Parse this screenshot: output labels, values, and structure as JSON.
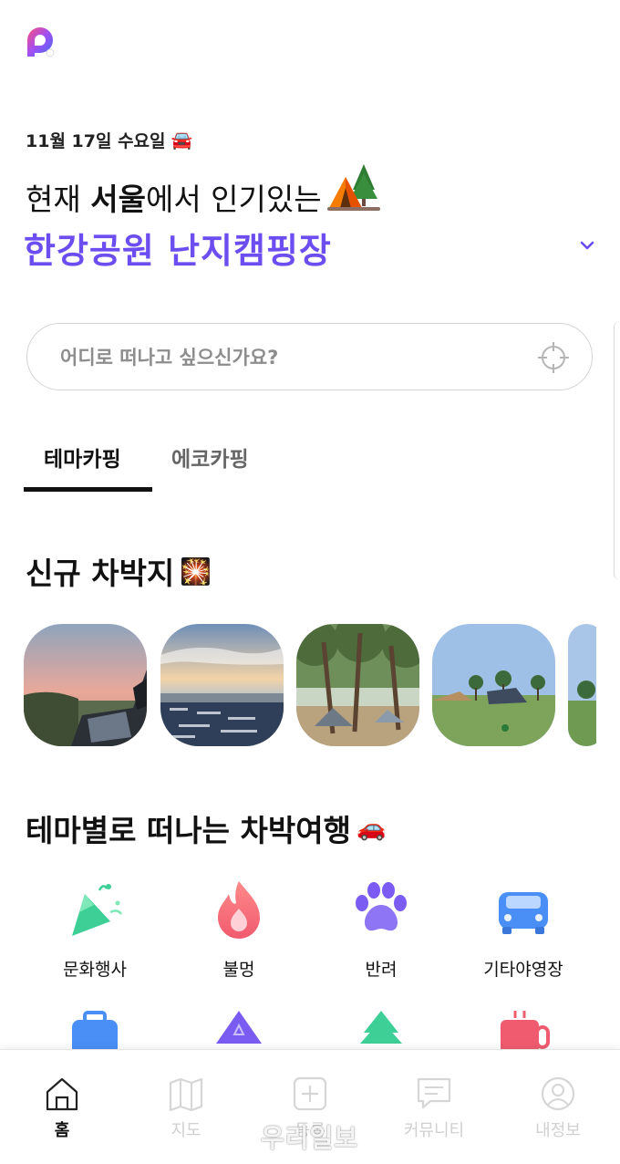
{
  "header": {
    "logo_icon": "app-logo",
    "date": "11월 17일 수요일",
    "date_emoji": "🚘",
    "headline_prefix": "현재 ",
    "headline_city": "서울",
    "headline_suffix": "에서 인기있는",
    "headline_icon": "tent-icon",
    "featured_spot": "한강공원 난지캠핑장",
    "accent_color": "#6b4df0"
  },
  "search": {
    "placeholder": "어디로 떠나고 싶으신가요?",
    "locate_icon": "crosshair-icon"
  },
  "tabs": [
    {
      "label": "테마카핑",
      "active": true
    },
    {
      "label": "에코카핑",
      "active": false
    }
  ],
  "new_spots": {
    "title": "신규 차박지",
    "title_emoji": "🎇",
    "thumbnails": [
      {
        "name": "sunset-car-photo"
      },
      {
        "name": "coast-sunset-photo"
      },
      {
        "name": "pine-forest-camp-photo"
      },
      {
        "name": "field-campsite-photo"
      },
      {
        "name": "campsite-photo-partial"
      }
    ]
  },
  "themes": {
    "title": "테마별로 떠나는 차박여행",
    "title_emoji": "🚗",
    "items": [
      {
        "label": "문화행사",
        "icon": "party-popper-icon",
        "color": "#3dcf95"
      },
      {
        "label": "불멍",
        "icon": "fire-icon",
        "color": "#f05b6f"
      },
      {
        "label": "반려",
        "icon": "paw-icon",
        "color": "#7a5cf2"
      },
      {
        "label": "기타야영장",
        "icon": "car-icon",
        "color": "#4a8ff5"
      },
      {
        "label": "",
        "icon": "bag-icon",
        "color": "#4a8ff5"
      },
      {
        "label": "",
        "icon": "mountain-icon",
        "color": "#7a5cf2"
      },
      {
        "label": "",
        "icon": "tree-icon",
        "color": "#3dcf95"
      },
      {
        "label": "",
        "icon": "mug-icon",
        "color": "#f05b6f"
      }
    ]
  },
  "bottom_nav": [
    {
      "label": "홈",
      "icon": "home-icon",
      "active": true
    },
    {
      "label": "지도",
      "icon": "map-icon",
      "active": false
    },
    {
      "label": "등록",
      "icon": "plus-square-icon",
      "active": false
    },
    {
      "label": "커뮤니티",
      "icon": "chat-icon",
      "active": false
    },
    {
      "label": "내정보",
      "icon": "user-icon",
      "active": false
    }
  ],
  "watermark": "우리일보"
}
